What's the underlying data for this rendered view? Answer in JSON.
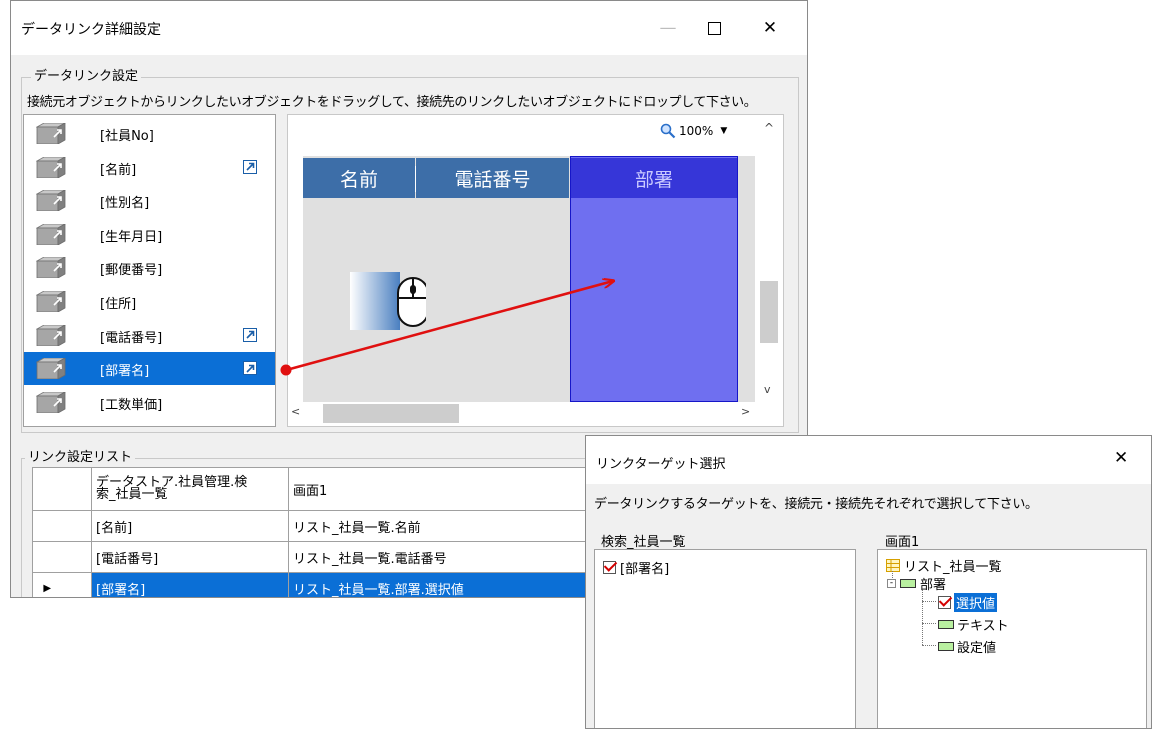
{
  "main_window": {
    "title": "データリンク詳細設定",
    "minimize_glyph": "—",
    "maximize_glyph": "☐",
    "close_glyph": "✕",
    "group_label": "データリンク設定",
    "instruction": "接続元オブジェクトからリンクしたいオブジェクトをドラッグして、接続先のリンクしたいオブジェクトにドロップして下さい。",
    "fields": [
      {
        "label": "[社員No]",
        "linked": false,
        "selected": false
      },
      {
        "label": "[名前]",
        "linked": true,
        "selected": false
      },
      {
        "label": "[性別名]",
        "linked": false,
        "selected": false
      },
      {
        "label": "[生年月日]",
        "linked": false,
        "selected": false
      },
      {
        "label": "[郵便番号]",
        "linked": false,
        "selected": false
      },
      {
        "label": "[住所]",
        "linked": false,
        "selected": false
      },
      {
        "label": "[電話番号]",
        "linked": true,
        "selected": false
      },
      {
        "label": "[部署名]",
        "linked": true,
        "selected": true
      },
      {
        "label": "[工数単価]",
        "linked": false,
        "selected": false
      }
    ],
    "zoom": "100%",
    "canvas_columns": [
      "名前",
      "電話番号",
      "部署"
    ],
    "link_list": {
      "label": "リンク設定リスト",
      "header": {
        "source": "データストア.社員管理.検\n索_社員一覧",
        "target": "画面1"
      },
      "rows": [
        {
          "source": "[名前]",
          "target": "リスト_社員一覧.名前",
          "current": false
        },
        {
          "source": "[電話番号]",
          "target": "リスト_社員一覧.電話番号",
          "current": false
        },
        {
          "source": "[部署名]",
          "target": "リスト_社員一覧.部署.選択値",
          "current": true
        }
      ]
    }
  },
  "dialog": {
    "title": "リンクターゲット選択",
    "close_glyph": "✕",
    "instruction": "データリンクするターゲットを、接続元・接続先それぞれで選択して下さい。",
    "source_group": "検索_社員一覧",
    "source_item": "[部署名]",
    "target_group": "画面1",
    "target_tree": {
      "root": "リスト_社員一覧",
      "node": "部署",
      "children": [
        "選択値",
        "テキスト",
        "設定値"
      ]
    }
  },
  "colors": {
    "selection": "#0b6fd6",
    "header_blue": "#3d6ea8",
    "drop_column": "#6f6ff0",
    "arrow": "#e01010"
  },
  "icons": [
    "cube-icon",
    "link-badge-icon",
    "magnifier-icon",
    "mouse-drag-icon",
    "table-icon",
    "checkbox-icon"
  ]
}
